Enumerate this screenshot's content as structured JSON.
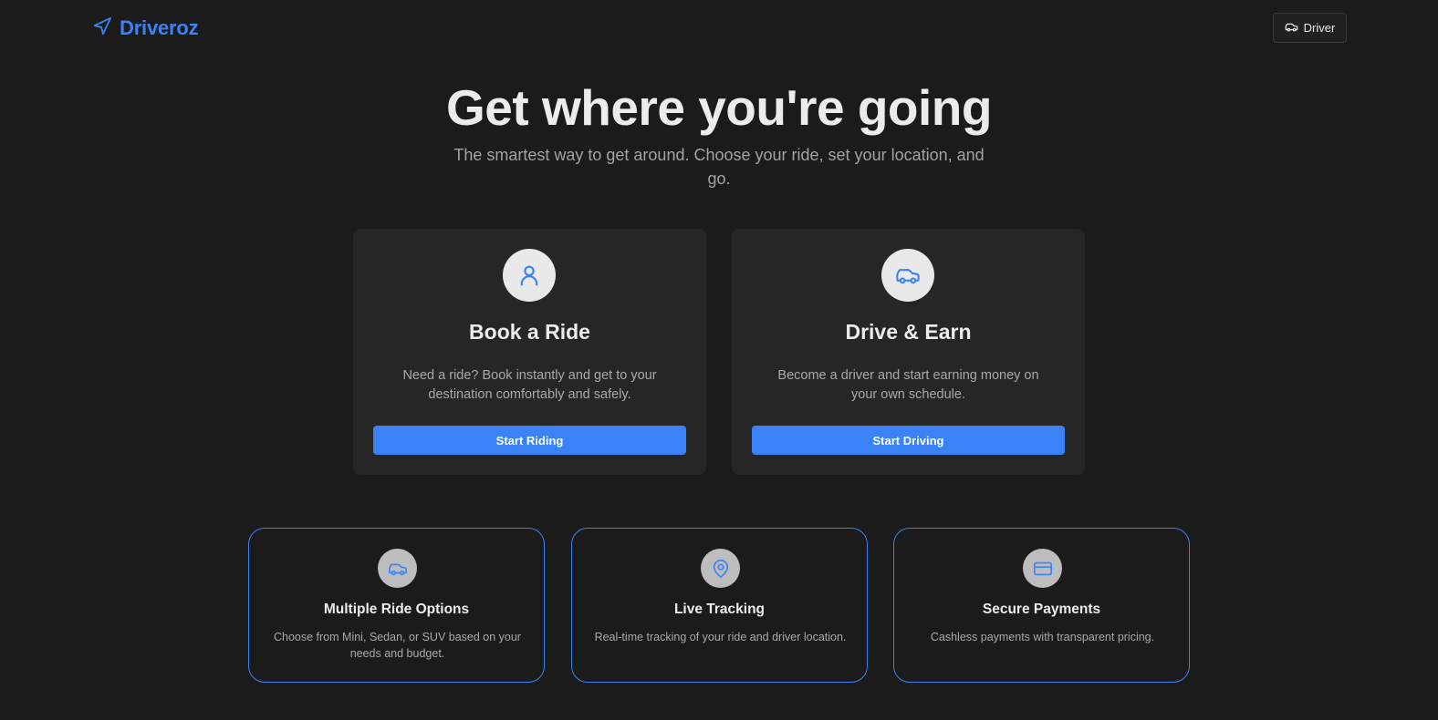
{
  "header": {
    "brand": "Driveroz",
    "brand_icon": "navigation-arrow-icon",
    "driver_button": "Driver",
    "driver_icon": "car-icon"
  },
  "hero": {
    "title": "Get where you're going",
    "subtitle": "The smartest way to get around. Choose your ride, set your location, and go."
  },
  "cards": [
    {
      "icon": "user-icon",
      "title": "Book a Ride",
      "description": "Need a ride? Book instantly and get to your destination comfortably and safely.",
      "button": "Start Riding"
    },
    {
      "icon": "car-icon",
      "title": "Drive & Earn",
      "description": "Become a driver and start earning money on your own schedule.",
      "button": "Start Driving"
    }
  ],
  "features": [
    {
      "icon": "car-icon",
      "title": "Multiple Ride Options",
      "description": "Choose from Mini, Sedan, or SUV based on your needs and budget."
    },
    {
      "icon": "map-pin-icon",
      "title": "Live Tracking",
      "description": "Real-time tracking of your ride and driver location."
    },
    {
      "icon": "credit-card-icon",
      "title": "Secure Payments",
      "description": "Cashless payments with transparent pricing."
    }
  ],
  "colors": {
    "background": "#1b1b1c",
    "accent": "#3b82f6",
    "card": "#262627"
  }
}
